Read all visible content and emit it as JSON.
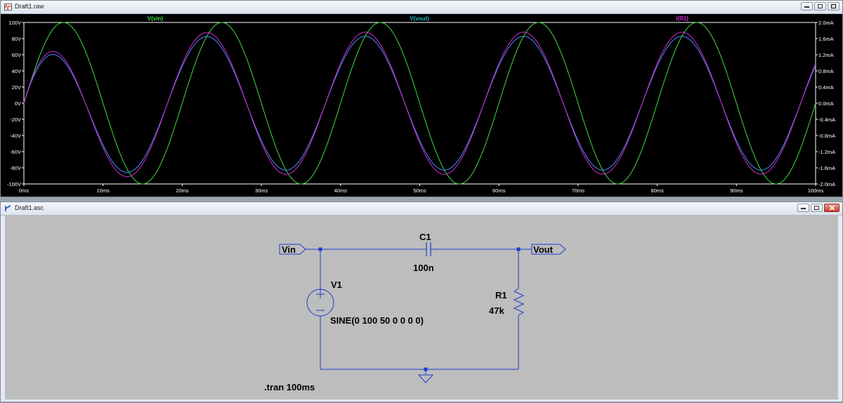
{
  "plot_window": {
    "title": "Draft1.raw",
    "trace_labels": [
      "V(vin)",
      "V(vout)",
      "I(R1)"
    ],
    "trace_colors": {
      "vin": "#3ddc3d",
      "vout": "#4a8cff",
      "ir1": "#d22ad2"
    },
    "left_axis_labels": [
      "100V",
      "80V",
      "60V",
      "40V",
      "20V",
      "0V",
      "-20V",
      "-40V",
      "-60V",
      "-80V",
      "-100V"
    ],
    "right_axis_labels": [
      "2.0mA",
      "1.6mA",
      "1.2mA",
      "0.8mA",
      "0.4mA",
      "0.0mA",
      "-0.4mA",
      "-0.8mA",
      "-1.2mA",
      "-1.6mA",
      "-2.0mA"
    ],
    "x_axis_labels": [
      "0ms",
      "10ms",
      "20ms",
      "30ms",
      "40ms",
      "50ms",
      "60ms",
      "70ms",
      "80ms",
      "90ms",
      "100ms"
    ]
  },
  "chart_data": {
    "type": "line",
    "title": "",
    "x_unit": "ms",
    "xlim": [
      0,
      100
    ],
    "ylim_left": [
      -100,
      100
    ],
    "ylim_right": [
      -2.0,
      2.0
    ],
    "left_unit": "V",
    "right_unit": "mA",
    "grid": false,
    "series": [
      {
        "name": "V(vin)",
        "axis": "left",
        "color": "#3ddc3d",
        "amplitude": 100,
        "frequency_hz": 50,
        "phase_deg": 0
      },
      {
        "name": "V(vout)",
        "axis": "left",
        "color": "#4a8cff",
        "amplitude": 82.8,
        "frequency_hz": 50,
        "phase_deg": 34,
        "starts_at_zero": true
      },
      {
        "name": "I(R1)",
        "axis": "right",
        "color": "#d22ad2",
        "amplitude": 1.76,
        "frequency_hz": 50,
        "phase_deg": 34,
        "starts_at_zero": true
      }
    ]
  },
  "schematic_window": {
    "title": "Draft1.asc",
    "components": {
      "c1_name": "C1",
      "c1_value": "100n",
      "v1_name": "V1",
      "v1_value": "SINE(0 100 50 0 0 0 0)",
      "r1_name": "R1",
      "r1_value": "47k"
    },
    "net_labels": {
      "vin": "Vin",
      "vout": "Vout"
    },
    "directive": ".tran 100ms"
  }
}
